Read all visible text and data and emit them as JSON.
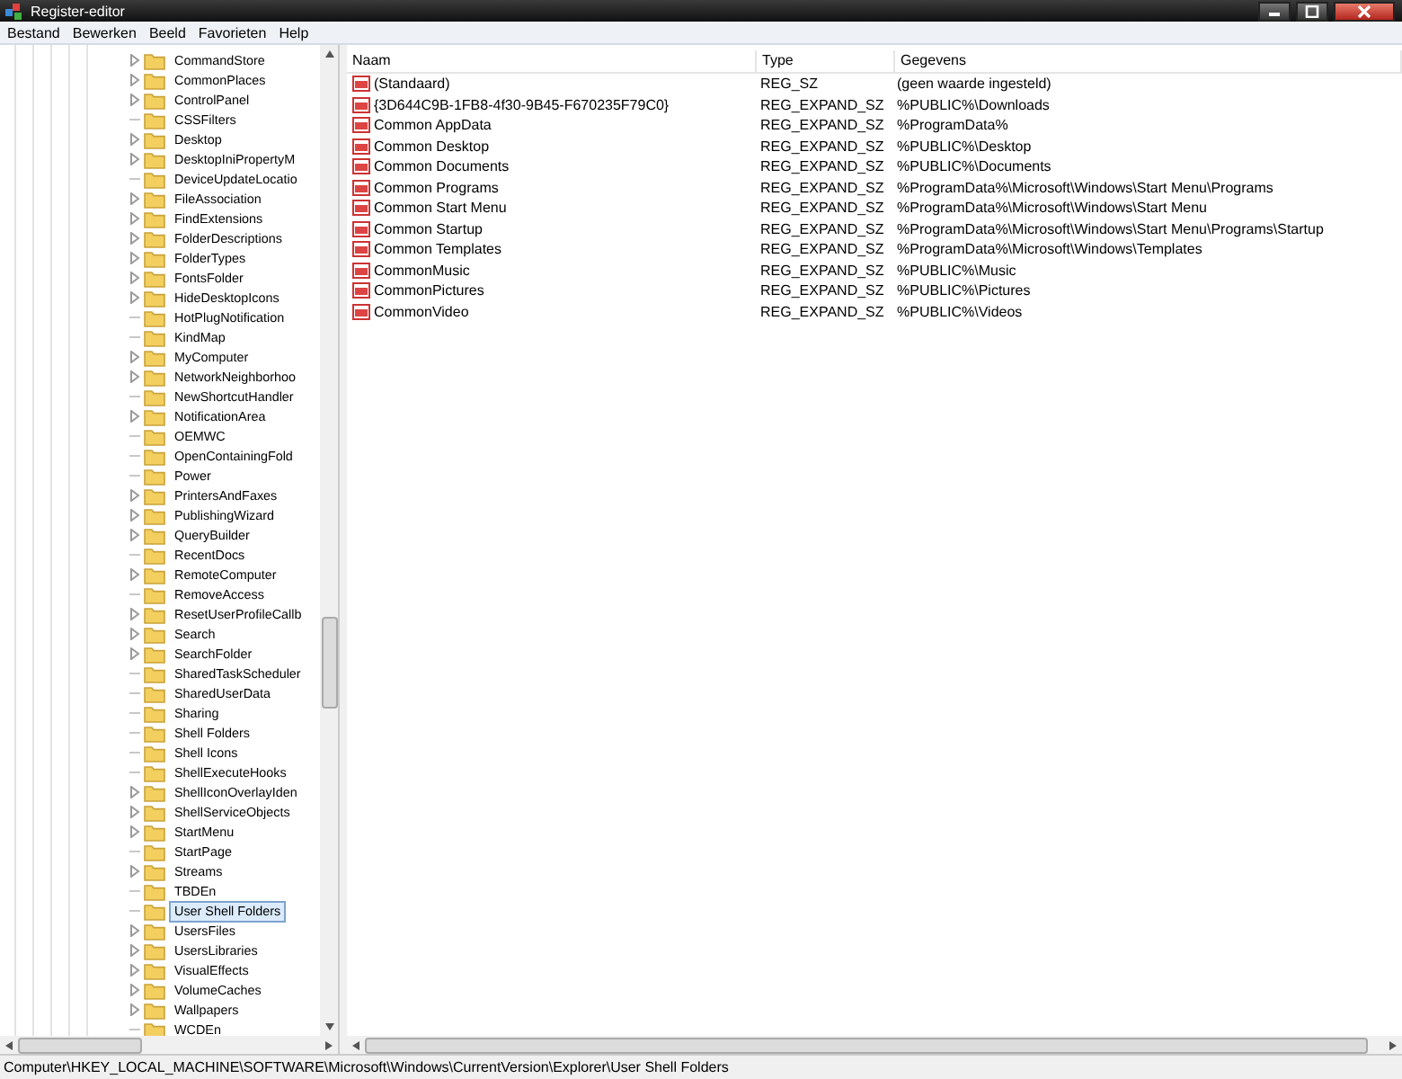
{
  "window": {
    "title": "Register-editor"
  },
  "menu": [
    "Bestand",
    "Bewerken",
    "Beeld",
    "Favorieten",
    "Help"
  ],
  "tree": {
    "items": [
      {
        "label": "CommandStore",
        "expandable": true,
        "selected": false
      },
      {
        "label": "CommonPlaces",
        "expandable": true,
        "selected": false
      },
      {
        "label": "ControlPanel",
        "expandable": true,
        "selected": false
      },
      {
        "label": "CSSFilters",
        "expandable": false,
        "selected": false
      },
      {
        "label": "Desktop",
        "expandable": true,
        "selected": false
      },
      {
        "label": "DesktopIniPropertyM",
        "expandable": true,
        "selected": false
      },
      {
        "label": "DeviceUpdateLocatio",
        "expandable": false,
        "selected": false
      },
      {
        "label": "FileAssociation",
        "expandable": true,
        "selected": false
      },
      {
        "label": "FindExtensions",
        "expandable": true,
        "selected": false
      },
      {
        "label": "FolderDescriptions",
        "expandable": true,
        "selected": false
      },
      {
        "label": "FolderTypes",
        "expandable": true,
        "selected": false
      },
      {
        "label": "FontsFolder",
        "expandable": true,
        "selected": false
      },
      {
        "label": "HideDesktopIcons",
        "expandable": true,
        "selected": false
      },
      {
        "label": "HotPlugNotification",
        "expandable": false,
        "selected": false
      },
      {
        "label": "KindMap",
        "expandable": false,
        "selected": false
      },
      {
        "label": "MyComputer",
        "expandable": true,
        "selected": false
      },
      {
        "label": "NetworkNeighborhoo",
        "expandable": true,
        "selected": false
      },
      {
        "label": "NewShortcutHandler",
        "expandable": false,
        "selected": false
      },
      {
        "label": "NotificationArea",
        "expandable": true,
        "selected": false
      },
      {
        "label": "OEMWC",
        "expandable": false,
        "selected": false
      },
      {
        "label": "OpenContainingFold",
        "expandable": false,
        "selected": false
      },
      {
        "label": "Power",
        "expandable": false,
        "selected": false
      },
      {
        "label": "PrintersAndFaxes",
        "expandable": true,
        "selected": false
      },
      {
        "label": "PublishingWizard",
        "expandable": true,
        "selected": false
      },
      {
        "label": "QueryBuilder",
        "expandable": true,
        "selected": false
      },
      {
        "label": "RecentDocs",
        "expandable": false,
        "selected": false
      },
      {
        "label": "RemoteComputer",
        "expandable": true,
        "selected": false
      },
      {
        "label": "RemoveAccess",
        "expandable": false,
        "selected": false
      },
      {
        "label": "ResetUserProfileCallb",
        "expandable": true,
        "selected": false
      },
      {
        "label": "Search",
        "expandable": true,
        "selected": false
      },
      {
        "label": "SearchFolder",
        "expandable": true,
        "selected": false
      },
      {
        "label": "SharedTaskScheduler",
        "expandable": false,
        "selected": false
      },
      {
        "label": "SharedUserData",
        "expandable": false,
        "selected": false
      },
      {
        "label": "Sharing",
        "expandable": false,
        "selected": false
      },
      {
        "label": "Shell Folders",
        "expandable": false,
        "selected": false
      },
      {
        "label": "Shell Icons",
        "expandable": false,
        "selected": false
      },
      {
        "label": "ShellExecuteHooks",
        "expandable": false,
        "selected": false
      },
      {
        "label": "ShellIconOverlayIden",
        "expandable": true,
        "selected": false
      },
      {
        "label": "ShellServiceObjects",
        "expandable": true,
        "selected": false
      },
      {
        "label": "StartMenu",
        "expandable": true,
        "selected": false
      },
      {
        "label": "StartPage",
        "expandable": false,
        "selected": false
      },
      {
        "label": "Streams",
        "expandable": true,
        "selected": false
      },
      {
        "label": "TBDEn",
        "expandable": false,
        "selected": false
      },
      {
        "label": "User Shell Folders",
        "expandable": false,
        "selected": true
      },
      {
        "label": "UsersFiles",
        "expandable": true,
        "selected": false
      },
      {
        "label": "UsersLibraries",
        "expandable": true,
        "selected": false
      },
      {
        "label": "VisualEffects",
        "expandable": true,
        "selected": false
      },
      {
        "label": "VolumeCaches",
        "expandable": true,
        "selected": false
      },
      {
        "label": "Wallpapers",
        "expandable": true,
        "selected": false
      },
      {
        "label": "WCDEn",
        "expandable": false,
        "selected": false
      }
    ]
  },
  "table": {
    "columns": [
      "Naam",
      "Type",
      "Gegevens"
    ],
    "rows": [
      [
        "(Standaard)",
        "REG_SZ",
        "(geen waarde ingesteld)"
      ],
      [
        "{3D644C9B-1FB8-4f30-9B45-F670235F79C0}",
        "REG_EXPAND_SZ",
        "%PUBLIC%\\Downloads"
      ],
      [
        "Common AppData",
        "REG_EXPAND_SZ",
        "%ProgramData%"
      ],
      [
        "Common Desktop",
        "REG_EXPAND_SZ",
        "%PUBLIC%\\Desktop"
      ],
      [
        "Common Documents",
        "REG_EXPAND_SZ",
        "%PUBLIC%\\Documents"
      ],
      [
        "Common Programs",
        "REG_EXPAND_SZ",
        "%ProgramData%\\Microsoft\\Windows\\Start Menu\\Programs"
      ],
      [
        "Common Start Menu",
        "REG_EXPAND_SZ",
        "%ProgramData%\\Microsoft\\Windows\\Start Menu"
      ],
      [
        "Common Startup",
        "REG_EXPAND_SZ",
        "%ProgramData%\\Microsoft\\Windows\\Start Menu\\Programs\\Startup"
      ],
      [
        "Common Templates",
        "REG_EXPAND_SZ",
        "%ProgramData%\\Microsoft\\Windows\\Templates"
      ],
      [
        "CommonMusic",
        "REG_EXPAND_SZ",
        "%PUBLIC%\\Music"
      ],
      [
        "CommonPictures",
        "REG_EXPAND_SZ",
        "%PUBLIC%\\Pictures"
      ],
      [
        "CommonVideo",
        "REG_EXPAND_SZ",
        "%PUBLIC%\\Videos"
      ]
    ]
  },
  "status_bar": "Computer\\HKEY_LOCAL_MACHINE\\SOFTWARE\\Microsoft\\Windows\\CurrentVersion\\Explorer\\User Shell Folders"
}
